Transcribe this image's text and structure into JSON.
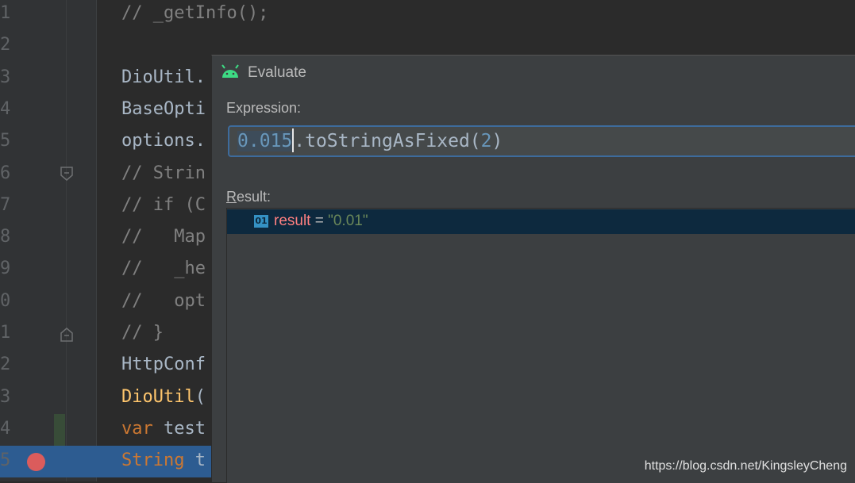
{
  "editor": {
    "lines": [
      {
        "num": "1",
        "tokens": [
          {
            "cls": "c-comment",
            "text": "// _getInfo();"
          }
        ]
      },
      {
        "num": "2",
        "tokens": []
      },
      {
        "num": "3",
        "tokens": [
          {
            "cls": "c-plain",
            "text": "DioUtil."
          }
        ]
      },
      {
        "num": "4",
        "tokens": [
          {
            "cls": "c-plain",
            "text": "BaseOpti"
          }
        ]
      },
      {
        "num": "5",
        "tokens": [
          {
            "cls": "c-plain",
            "text": "options."
          }
        ]
      },
      {
        "num": "6",
        "tokens": [
          {
            "cls": "c-comment",
            "text": "// Strin"
          }
        ]
      },
      {
        "num": "7",
        "tokens": [
          {
            "cls": "c-comment",
            "text": "// if (C"
          }
        ]
      },
      {
        "num": "8",
        "tokens": [
          {
            "cls": "c-comment",
            "text": "//   Map"
          }
        ]
      },
      {
        "num": "9",
        "tokens": [
          {
            "cls": "c-comment",
            "text": "//   _he"
          }
        ]
      },
      {
        "num": "0",
        "tokens": [
          {
            "cls": "c-comment",
            "text": "//   opt"
          }
        ]
      },
      {
        "num": "1",
        "tokens": [
          {
            "cls": "c-comment",
            "text": "// }"
          }
        ]
      },
      {
        "num": "2",
        "tokens": [
          {
            "cls": "c-plain",
            "text": "HttpConf"
          }
        ]
      },
      {
        "num": "3",
        "tokens": [
          {
            "cls": "c-fn",
            "text": "DioUtil"
          },
          {
            "cls": "c-plain",
            "text": "("
          }
        ]
      },
      {
        "num": "4",
        "tokens": [
          {
            "cls": "c-keyword",
            "text": "var "
          },
          {
            "cls": "c-plain",
            "text": "test"
          }
        ]
      },
      {
        "num": "5",
        "tokens": [
          {
            "cls": "c-keyword",
            "text": "String "
          },
          {
            "cls": "c-plain",
            "text": "t"
          }
        ]
      }
    ]
  },
  "dialog": {
    "title": "Evaluate",
    "expression_label": "Expression:",
    "expression": {
      "selected": "0.015",
      "rest_1": ".toStringAsFixed(",
      "arg": "2",
      "rest_2": ")"
    },
    "result_label_first": "R",
    "result_label_rest": "esult:",
    "result": {
      "icon_text": "01",
      "name": "result",
      "eq": " = ",
      "value": "\"0.01\""
    }
  },
  "watermark": "https://blog.csdn.net/KingsleyCheng",
  "colors": {
    "background": "#2b2b2b",
    "dialog": "#3c3f41",
    "selection": "#0d293e",
    "breakpoint": "#db5c5c",
    "exec_line": "#2d5c91"
  }
}
